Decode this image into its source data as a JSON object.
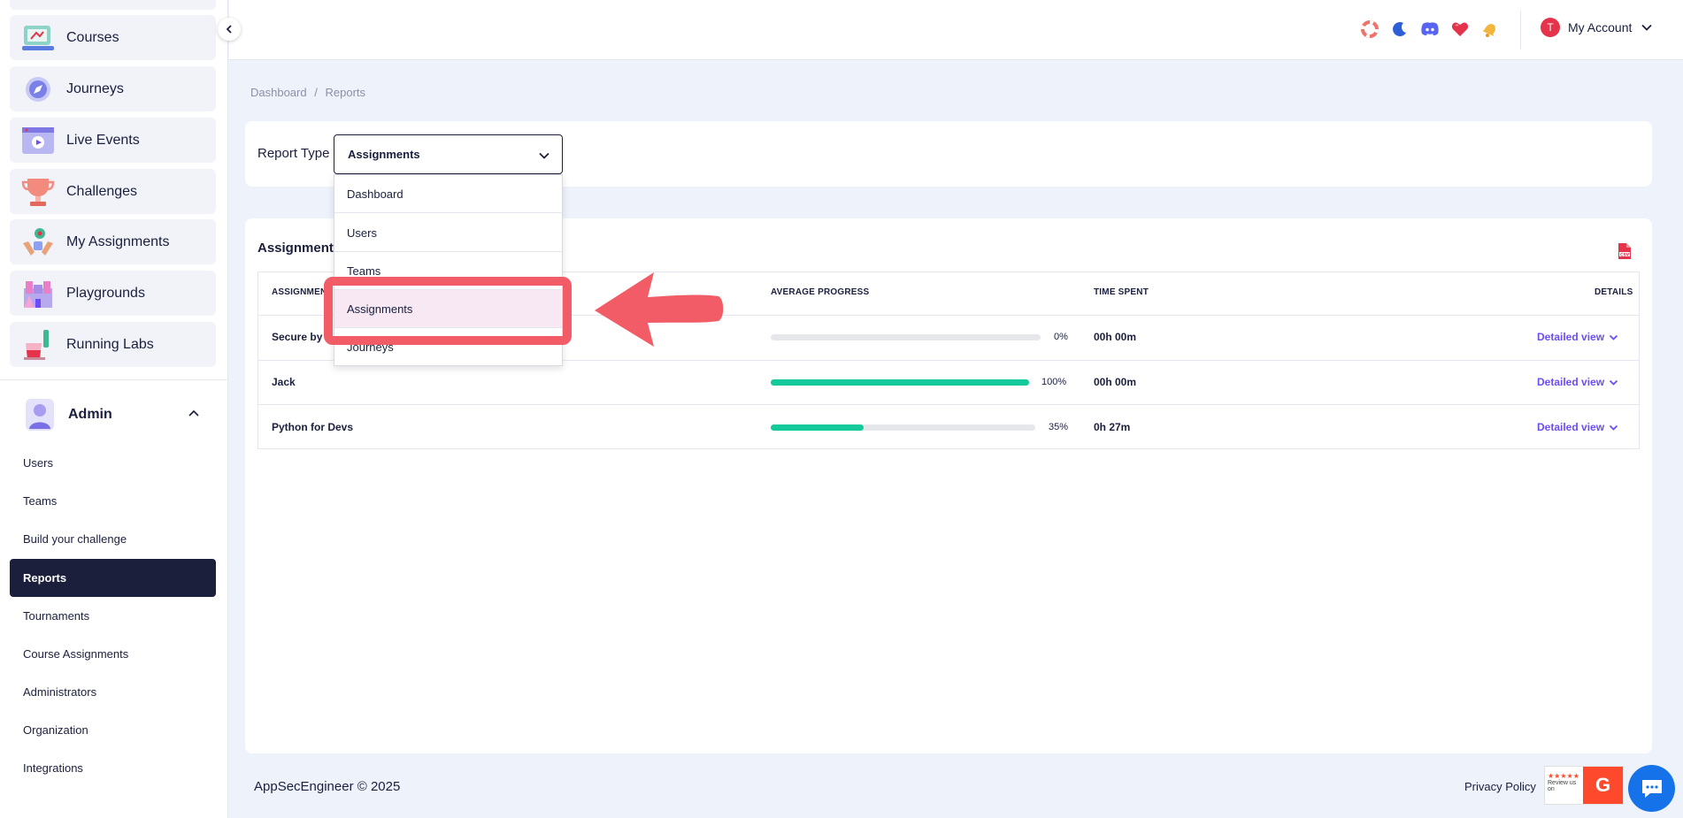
{
  "sidebar": {
    "items": [
      {
        "label": "Courses",
        "icon": "courses-icon"
      },
      {
        "label": "Journeys",
        "icon": "compass-icon"
      },
      {
        "label": "Live Events",
        "icon": "live-events-icon"
      },
      {
        "label": "Challenges",
        "icon": "trophy-icon"
      },
      {
        "label": "My Assignments",
        "icon": "assignments-icon"
      },
      {
        "label": "Playgrounds",
        "icon": "playground-icon"
      },
      {
        "label": "Running Labs",
        "icon": "flask-icon"
      }
    ],
    "admin": {
      "label": "Admin",
      "items": [
        "Users",
        "Teams",
        "Build your challenge",
        "Reports",
        "Tournaments",
        "Course Assignments",
        "Administrators",
        "Organization",
        "Integrations"
      ],
      "active": "Reports"
    }
  },
  "topbar": {
    "icons": [
      "lifebuoy-icon",
      "moon-icon",
      "discord-icon",
      "heart-icon",
      "bell-icon"
    ],
    "account": {
      "initial": "T",
      "label": "My Account"
    }
  },
  "breadcrumb": {
    "items": [
      "Dashboard",
      "/",
      "Reports"
    ]
  },
  "report": {
    "type_label": "Report Type",
    "selected": "Assignments",
    "options": [
      "Dashboard",
      "Users",
      "Teams",
      "Assignments",
      "Journeys"
    ]
  },
  "table": {
    "title": "Assignments",
    "headers": {
      "assignment": "ASSIGNMENT",
      "progress": "AVERAGE PROGRESS",
      "time": "TIME SPENT",
      "details": "DETAILS"
    },
    "rows": [
      {
        "name": "Secure by Design",
        "progress": 0,
        "progress_label": "0%",
        "time": "00h 00m",
        "details": "Detailed view"
      },
      {
        "name": "Jack",
        "progress": 100,
        "progress_label": "100%",
        "time": "00h 00m",
        "details": "Detailed view"
      },
      {
        "name": "Python for Devs",
        "progress": 35,
        "progress_label": "35%",
        "time": "0h 27m",
        "details": "Detailed view"
      }
    ]
  },
  "footer": {
    "copyright": "AppSecEngineer © 2025",
    "privacy": "Privacy Policy",
    "g2": {
      "stars": "★★★★★",
      "text": "Review us on",
      "logo": "G"
    }
  },
  "colors": {
    "accent": "#6c4cf5",
    "progress": "#14c99a",
    "active_nav": "#1b1f3b",
    "annotation": "#f25c66"
  }
}
